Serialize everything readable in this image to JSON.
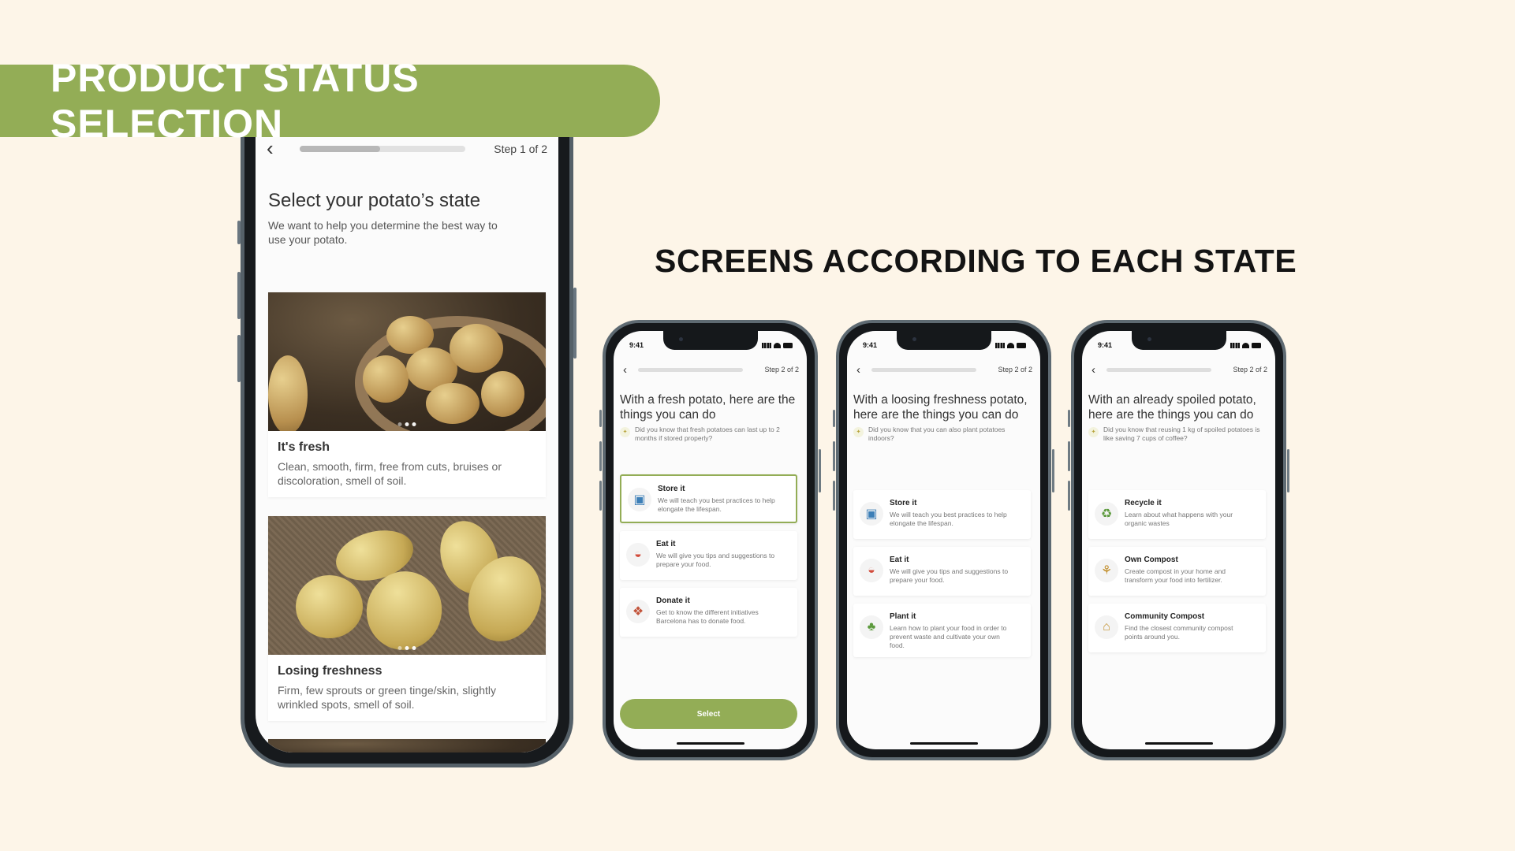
{
  "header": {
    "title": "PRODUCT STATUS SELECTION",
    "subheading": "SCREENS ACCORDING TO EACH STATE"
  },
  "main_screen": {
    "step": "Step 1 of 2",
    "title": "Select your potato’s state",
    "subtitle": "We want to help you determine the best way to use your potato.",
    "cards": [
      {
        "title": "It's fresh",
        "desc": "Clean, smooth, firm, free from cuts, bruises or discoloration, smell of soil."
      },
      {
        "title": "Losing freshness",
        "desc": "Firm, few sprouts or green tinge/skin, slightly wrinkled spots, smell of soil."
      }
    ]
  },
  "screens": [
    {
      "time": "9:41",
      "step": "Step 2 of 2",
      "title": "With a fresh potato, here are the things you can do",
      "tip": "Did you know that fresh potatoes can last up to 2 months if stored properly?",
      "options": [
        {
          "title": "Store it",
          "desc": "We will teach you best practices to help elongate the lifespan.",
          "icon": "storage-icon"
        },
        {
          "title": "Eat it",
          "desc": "We will give you tips and suggestions to prepare your food.",
          "icon": "food-icon"
        },
        {
          "title": "Donate it",
          "desc": "Get to know the different initiatives Barcelona has to donate food.",
          "icon": "donate-icon"
        }
      ],
      "button": "Select"
    },
    {
      "time": "9:41",
      "step": "Step 2 of 2",
      "title": "With a loosing freshness potato, here are the things you can do",
      "tip": "Did you know that you can also plant potatoes indoors?",
      "options": [
        {
          "title": "Store it",
          "desc": "We will teach you best practices to help elongate the lifespan.",
          "icon": "storage-icon"
        },
        {
          "title": "Eat it",
          "desc": "We will give you tips and suggestions to prepare your food.",
          "icon": "food-icon"
        },
        {
          "title": "Plant it",
          "desc": "Learn how to plant your food in order to prevent waste and cultivate your own food.",
          "icon": "plant-icon"
        }
      ]
    },
    {
      "time": "9:41",
      "step": "Step 2 of 2",
      "title": "With an already spoiled potato, here are the things you can do",
      "tip": "Did you know that reusing 1 kg of spoiled potatoes is like saving 7 cups of coffee?",
      "options": [
        {
          "title": "Recycle it",
          "desc": "Learn about what happens with your organic wastes",
          "icon": "recycle-icon"
        },
        {
          "title": "Own Compost",
          "desc": "Create compost in your home and transform your food into fertilizer.",
          "icon": "compost-icon"
        },
        {
          "title": "Community Compost",
          "desc": "Find the closest community compost points around you.",
          "icon": "community-compost-icon"
        }
      ]
    }
  ],
  "colors": {
    "accent": "#93ad56",
    "background": "#fdf5e8"
  }
}
